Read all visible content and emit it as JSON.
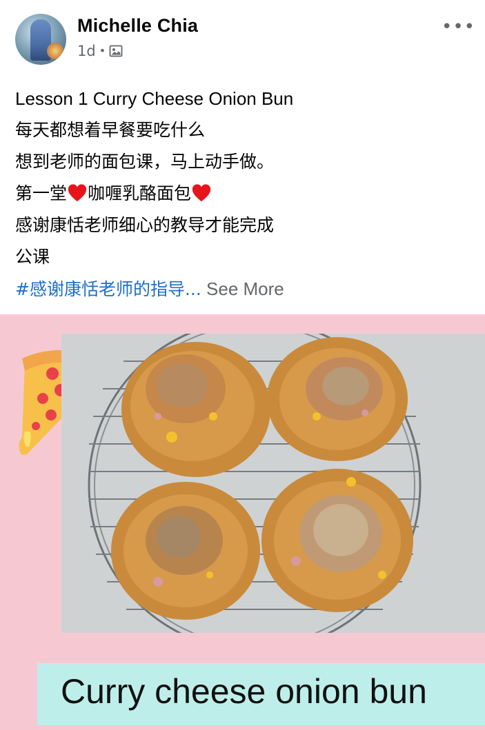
{
  "post": {
    "author": "Michelle Chia",
    "time": "1d",
    "separator": "•",
    "more_label": "•••",
    "text_lines": [
      "Lesson 1   Curry Cheese Onion Bun",
      "每天都想着早餐要吃什么",
      "想到老师的面包课，马上动手做。"
    ],
    "line4_before": "第一堂",
    "line4_middle": "咖喱乳酪面包",
    "line5": "感谢康恬老师细心的教导才能完成",
    "line6": "公课",
    "hashtag": "#感谢康恬老师的指导...",
    "see_more": " See More"
  },
  "photo": {
    "caption": "Curry cheese onion bun",
    "background_color": "#f6c9d2",
    "caption_bg_color": "#bdeeea"
  },
  "colors": {
    "heart": "#e8141c",
    "hashtag": "#1b6fc9",
    "meta": "#65676b"
  },
  "icons": {
    "group": "group-photo-icon",
    "more": "more-options-icon",
    "heart": "red-heart-emoji",
    "pizza": "pizza-slice-sticker"
  }
}
